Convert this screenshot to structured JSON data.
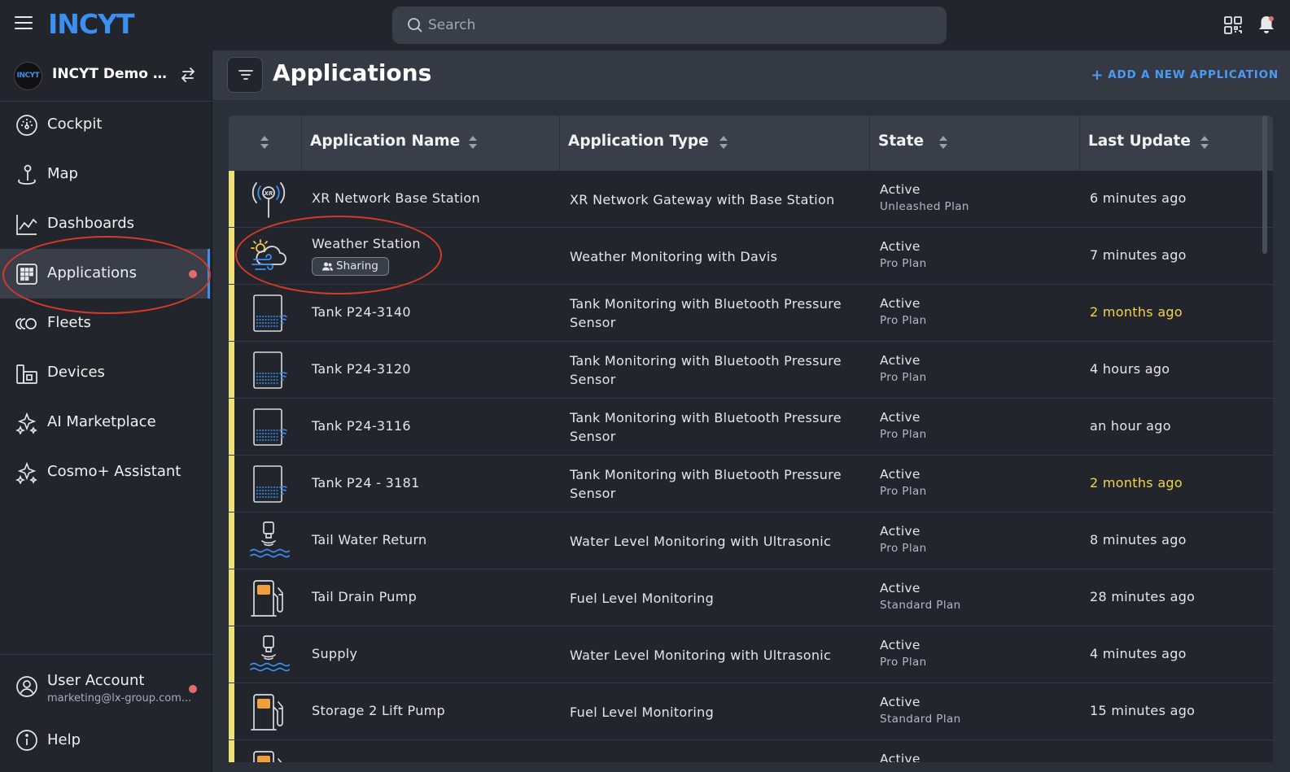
{
  "topbar": {
    "logo": "INCYT",
    "search_placeholder": "Search"
  },
  "sidebar": {
    "org": {
      "avatar_text": "INCYT",
      "name": "INCYT Demo O..."
    },
    "items": [
      {
        "label": "Cockpit",
        "icon": "gauge-icon"
      },
      {
        "label": "Map",
        "icon": "map-pin-icon"
      },
      {
        "label": "Dashboards",
        "icon": "chart-icon"
      },
      {
        "label": "Applications",
        "icon": "grid-icon",
        "active": true
      },
      {
        "label": "Fleets",
        "icon": "fleets-icon"
      },
      {
        "label": "Devices",
        "icon": "devices-icon"
      },
      {
        "label": "AI Marketplace",
        "icon": "sparkles-icon"
      },
      {
        "label": "Cosmo+ Assistant",
        "icon": "sparkles-icon"
      }
    ],
    "user": {
      "label": "User Account",
      "email": "marketing@lx-group.com..."
    },
    "help": {
      "label": "Help"
    }
  },
  "header": {
    "title": "Applications",
    "add_label": "ADD A NEW APPLICATION"
  },
  "table": {
    "columns": [
      "Application Name",
      "Application Type",
      "State",
      "Last Update"
    ],
    "rows": [
      {
        "icon": "antenna-icon",
        "name": "XR Network Base Station",
        "type": "XR Network Gateway with Base Station",
        "state": "Active",
        "plan": "Unleashed Plan",
        "updated": "6 minutes ago"
      },
      {
        "icon": "weather-icon",
        "name": "Weather Station",
        "badge": "Sharing",
        "type": "Weather Monitoring with Davis",
        "state": "Active",
        "plan": "Pro Plan",
        "updated": "7 minutes ago"
      },
      {
        "icon": "tank-icon",
        "name": "Tank P24-3140",
        "type": "Tank Monitoring with Bluetooth Pressure Sensor",
        "state": "Active",
        "plan": "Pro Plan",
        "updated": "2 months ago",
        "stale": true
      },
      {
        "icon": "tank-icon",
        "name": "Tank P24-3120",
        "type": "Tank Monitoring with Bluetooth Pressure Sensor",
        "state": "Active",
        "plan": "Pro Plan",
        "updated": "4 hours ago"
      },
      {
        "icon": "tank-icon",
        "name": "Tank P24-3116",
        "type": "Tank Monitoring with Bluetooth Pressure Sensor",
        "state": "Active",
        "plan": "Pro Plan",
        "updated": "an hour ago"
      },
      {
        "icon": "tank-icon",
        "name": "Tank P24 - 3181",
        "type": "Tank Monitoring with Bluetooth Pressure Sensor",
        "state": "Active",
        "plan": "Pro Plan",
        "updated": "2 months ago",
        "stale": true
      },
      {
        "icon": "ultrasonic-icon",
        "name": "Tail Water Return",
        "type": "Water Level Monitoring with Ultrasonic",
        "state": "Active",
        "plan": "Pro Plan",
        "updated": "8 minutes ago"
      },
      {
        "icon": "fuel-icon",
        "name": "Tail Drain Pump",
        "type": "Fuel Level Monitoring",
        "state": "Active",
        "plan": "Standard Plan",
        "updated": "28 minutes ago"
      },
      {
        "icon": "ultrasonic-icon",
        "name": "Supply",
        "type": "Water Level Monitoring with Ultrasonic",
        "state": "Active",
        "plan": "Pro Plan",
        "updated": "4 minutes ago"
      },
      {
        "icon": "fuel-icon",
        "name": "Storage 2 Lift Pump",
        "type": "Fuel Level Monitoring",
        "state": "Active",
        "plan": "Standard Plan",
        "updated": "15 minutes ago"
      },
      {
        "icon": "fuel-icon",
        "name": "",
        "type": "",
        "state": "Active",
        "plan": "",
        "updated": ""
      }
    ]
  },
  "colors": {
    "accent": "#3b8ff0",
    "row_marker": "#efe07a",
    "stale_text": "#f2d54a",
    "annotation": "#d63a2a",
    "notification_dot": "#e26d6d"
  }
}
